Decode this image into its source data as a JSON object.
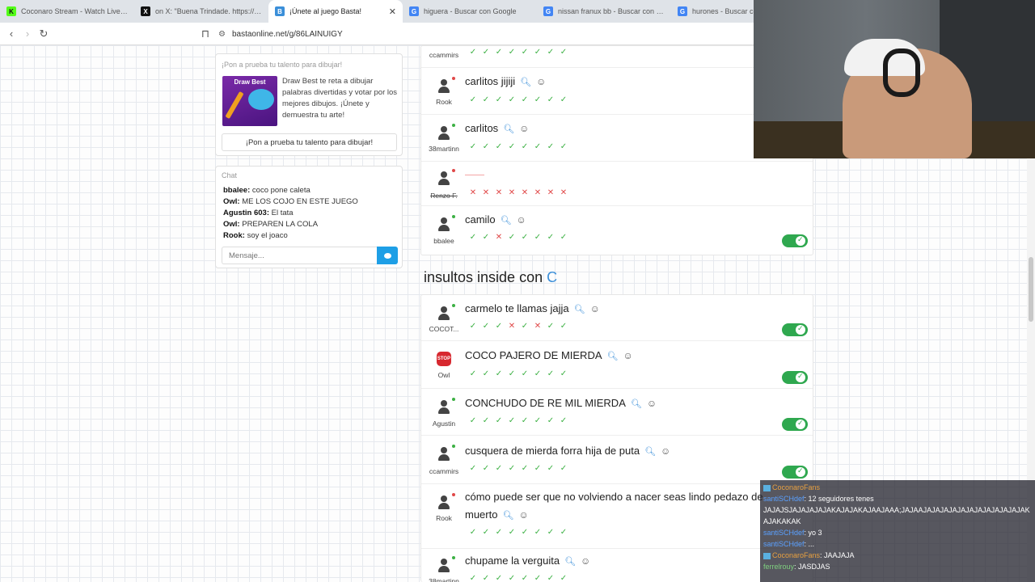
{
  "browser": {
    "tabs": [
      {
        "label": "Coconaro Stream - Watch Live on Ki",
        "color": "#53fc18",
        "glyph": "K"
      },
      {
        "label": "on X: \"Buena Trindade. https://t.co/k",
        "color": "#111111",
        "glyph": "X"
      },
      {
        "label": "¡Únete al juego Basta!",
        "color": "#3b8fd9",
        "glyph": "B",
        "active": true
      },
      {
        "label": "higuera - Buscar con Google",
        "color": "#4285f4",
        "glyph": "G"
      },
      {
        "label": "nissan franux bb - Buscar con Google",
        "color": "#4285f4",
        "glyph": "G"
      },
      {
        "label": "hurones - Buscar con Go",
        "color": "#4285f4",
        "glyph": "G"
      }
    ],
    "url": "bastaonline.net/g/86LAINUIGY"
  },
  "promo": {
    "header": "¡Pon a prueba tu talento para dibujar!",
    "thumb_title": "Draw Best",
    "description": "Draw Best te reta a dibujar palabras divertidas y votar por los mejores dibujos. ¡Únete y demuestra tu arte!",
    "button": "¡Pon a prueba tu talento para dibujar!"
  },
  "chat": {
    "header": "Chat",
    "messages": [
      {
        "user": "bbalee:",
        "text": "coco pone caleta"
      },
      {
        "user": "Owl:",
        "text": "ME LOS COJO EN ESTE JUEGO"
      },
      {
        "user": "Agustin 603:",
        "text": "El tata"
      },
      {
        "user": "Owl:",
        "text": "PREPAREN LA COLA"
      },
      {
        "user": "Rook:",
        "text": "soy el joaco"
      }
    ],
    "placeholder": "Mensaje..."
  },
  "list1": [
    {
      "user": "ccammirs",
      "answer": "",
      "checks": "oooooooo"
    },
    {
      "user": "Rook",
      "answer": "carlitos jijiji",
      "checks": "oooooooo"
    },
    {
      "user": "38martinn",
      "answer": "carlitos",
      "checks": "oooooooo"
    },
    {
      "user": "Renzo F.",
      "answer": "",
      "checks": "xxxxxxxx"
    },
    {
      "user": "bbalee",
      "answer": "camilo",
      "checks": "ooxooooo"
    }
  ],
  "section": {
    "title": "insultos inside con",
    "letter": "C"
  },
  "list2": [
    {
      "user": "COCOT...",
      "answer": "carmelo te llamas jajja",
      "checks": "oooxoxoo"
    },
    {
      "user": "Owl",
      "answer": "COCO PAJERO DE MIERDA",
      "checks": "oooooooo",
      "stop": true
    },
    {
      "user": "Agustin",
      "answer": "CONCHUDO DE RE MIL MIERDA",
      "checks": "oooooooo"
    },
    {
      "user": "ccammirs",
      "answer": "cusquera de mierda forra hija de puta",
      "checks": "oooooooo"
    },
    {
      "user": "Rook",
      "answer1": "cómo puede ser que no volviendo a nacer seas lindo pedazo de",
      "answer2": "muerto",
      "checks": "oooooooo"
    },
    {
      "user": "38martinn",
      "answer": "chupame la verguita",
      "checks": "oooooooo"
    }
  ],
  "stream_chat": [
    {
      "name": "CoconaroFans",
      "text": ""
    },
    {
      "name": "santiSCHdef",
      "text": ": 12 seguidores tenes"
    },
    {
      "name": "",
      "text": "JAJAJSJAJAJAJAJAKAJAJAKAJAAJAAA;JAJAAJAJAJAJAJAJAJAJAJAJAJAJAKAJAKAKAK"
    },
    {
      "name": "santiSCHdef",
      "text": ": yo 3"
    },
    {
      "name": "santiSCHdef",
      "text": ": ..."
    },
    {
      "name": "CoconaroFans",
      "text": ": JAAJAJA"
    },
    {
      "name": "ferrelrouy",
      "text": ": JASDJAS"
    }
  ]
}
